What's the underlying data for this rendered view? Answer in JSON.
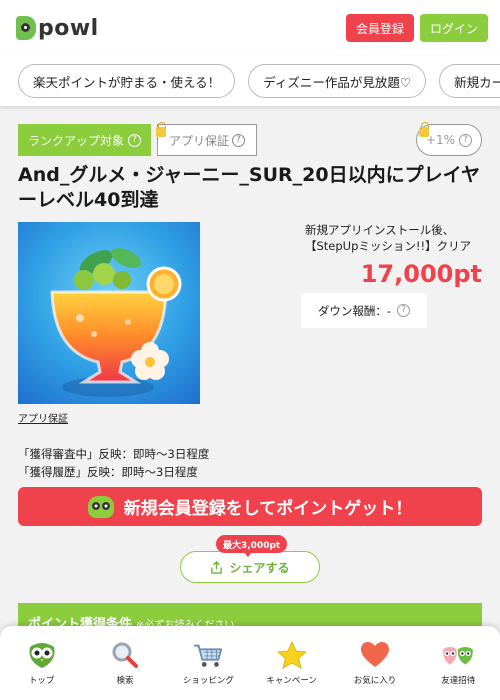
{
  "header": {
    "logo_text": "powl",
    "signup_label": "会員登録",
    "login_label": "ログイン"
  },
  "chips": [
    "楽天ポイントが貯まる・使える！",
    "ディズニー作品が見放題♡",
    "新規カード"
  ],
  "badges": {
    "rank_up": "ランクアップ対象",
    "app_guarantee": "アプリ保証",
    "plus_rate": "+1%"
  },
  "title": "And_グルメ・ジャーニー_SUR_20日以内にプレイヤーレベル40到達",
  "app_label": "アプリ保証",
  "install": {
    "line1": "新規アプリインストール後、",
    "line2": "【StepUpミッション!!】クリア"
  },
  "points": "17,000pt",
  "down_reward": "ダウン報酬：-",
  "reflect": {
    "line1": "「獲得審査中」反映：即時〜3日程度",
    "line2": "「獲得履歴」反映：即時〜3日程度"
  },
  "cta_label": "新規会員登録をしてポイントゲット！",
  "share": {
    "tag": "最大3,000pt",
    "label": "シェアする"
  },
  "conditions": {
    "title": "ポイント獲得条件",
    "note": "※必ずお読みください"
  },
  "bottom_nav": [
    {
      "label": "トップ",
      "icon": "owl-icon"
    },
    {
      "label": "検索",
      "icon": "search-icon"
    },
    {
      "label": "ショッピング",
      "icon": "cart-icon"
    },
    {
      "label": "キャンペーン",
      "icon": "star-icon"
    },
    {
      "label": "お気に入り",
      "icon": "heart-icon"
    },
    {
      "label": "友達招待",
      "icon": "friends-icon"
    }
  ],
  "colors": {
    "brand_green": "#8ccd3e",
    "accent_red": "#f0424d",
    "background": "#f2f2f2"
  }
}
